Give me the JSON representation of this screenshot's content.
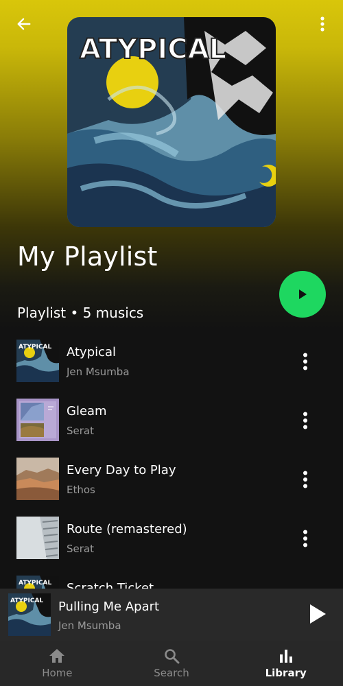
{
  "playlist": {
    "title": "My Playlist",
    "meta": "Playlist • 5 musics",
    "cover_text": "ATYPICAL"
  },
  "icons": {
    "back": "arrow-left-icon",
    "more": "more-vertical-icon",
    "play": "play-icon",
    "home": "home-icon",
    "search": "search-icon",
    "library": "bar-chart-icon"
  },
  "colors": {
    "accent_green": "#1ed760",
    "header_yellow": "#d9c60a",
    "background": "#121212",
    "mini_player": "#292929",
    "bottom_nav": "#282828"
  },
  "tracks": [
    {
      "title": "Atypical",
      "artist": "Jen Msumba"
    },
    {
      "title": "Gleam",
      "artist": "Serat"
    },
    {
      "title": "Every Day to Play",
      "artist": "Ethos"
    },
    {
      "title": "Route (remastered)",
      "artist": "Serat"
    },
    {
      "title": "Scratch Ticket",
      "artist": ""
    }
  ],
  "now_playing": {
    "title": "Pulling Me Apart",
    "artist": "Jen Msumba"
  },
  "nav": {
    "home": "Home",
    "search": "Search",
    "library": "Library",
    "active": "library"
  }
}
